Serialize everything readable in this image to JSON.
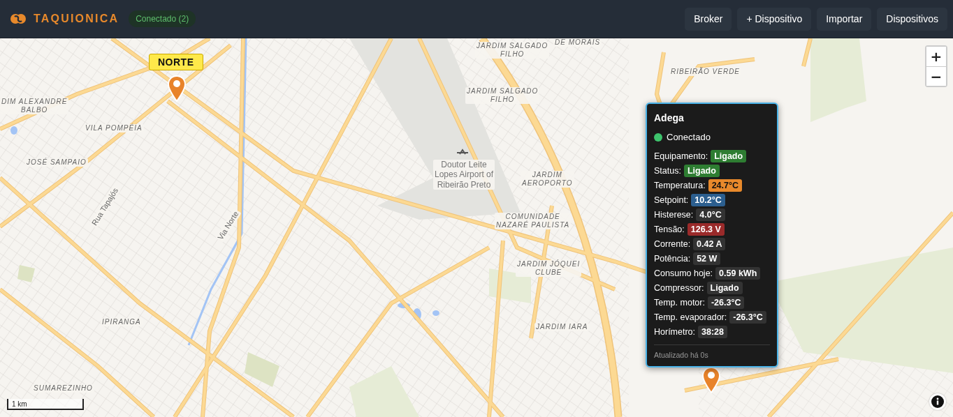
{
  "header": {
    "brand": "TAQUIONICA",
    "connection": "Conectado (2)",
    "buttons": [
      "Broker",
      "+ Dispositivo",
      "Importar",
      "Dispositivos"
    ]
  },
  "map": {
    "labels": [
      {
        "text": "JARDIM SALGADO\nFILHO",
        "kind": "district"
      },
      {
        "text": "DE MORAIS",
        "kind": "district"
      },
      {
        "text": "RIBEIRÃO VERDE",
        "kind": "district"
      },
      {
        "text": "DIM ALEXANDRE\nBALBO",
        "kind": "district"
      },
      {
        "text": "VILA POMPÉIA",
        "kind": "district"
      },
      {
        "text": "JOSÉ SAMPAIO",
        "kind": "district"
      },
      {
        "text": "JARDIM SALGADO\nFILHO",
        "kind": "district"
      },
      {
        "text": "Doutor Leite\nLopes Airport of\nRibeirão Preto",
        "kind": "poi"
      },
      {
        "text": "JARDIM\nAEROPORTO",
        "kind": "district"
      },
      {
        "text": "COMUNIDADE\nNAZARÉ PAULISTA",
        "kind": "district"
      },
      {
        "text": "JARDIM JÓQUEI\nCLUBE",
        "kind": "district"
      },
      {
        "text": "JARDIM IARA",
        "kind": "district"
      },
      {
        "text": "IPIRANGA",
        "kind": "district"
      },
      {
        "text": "SUMAREZINHO",
        "kind": "district"
      },
      {
        "text": "Rua Tapajós",
        "kind": "street"
      },
      {
        "text": "Via Norte",
        "kind": "street"
      }
    ],
    "markers": [
      {
        "kind": "tagged",
        "label": "NORTE"
      },
      {
        "kind": "plain"
      }
    ],
    "zoom_buttons": [
      "+",
      "−"
    ],
    "scale": "1 km"
  },
  "popup": {
    "title": "Adega",
    "status": {
      "text": "Conectado",
      "color": "#3ec46d"
    },
    "rows": [
      {
        "label": "Equipamento:",
        "value": "Ligado",
        "color": "#2e7d32"
      },
      {
        "label": "Status:",
        "value": "Ligado",
        "color": "#2e7d32"
      },
      {
        "label": "Temperatura:",
        "value": "24.7°C",
        "color": "#e8892b"
      },
      {
        "label": "Setpoint:",
        "value": "10.2°C",
        "color": "#2c5f8f"
      },
      {
        "label": "Histerese:",
        "value": "4.0°C",
        "color": "#333333"
      },
      {
        "label": "Tensão:",
        "value": "126.3 V",
        "color": "#9a2a2a"
      },
      {
        "label": "Corrente:",
        "value": "0.42 A",
        "color": "#333333"
      },
      {
        "label": "Potência:",
        "value": "52 W",
        "color": "#333333"
      },
      {
        "label": "Consumo hoje:",
        "value": "0.59 kWh",
        "color": "#333333"
      },
      {
        "label": "Compressor:",
        "value": "Ligado",
        "color": "#333333"
      },
      {
        "label": "Temp. motor:",
        "value": "-26.3°C",
        "color": "#333333"
      },
      {
        "label": "Temp. evaporador:",
        "value": "-26.3°C",
        "color": "#333333"
      },
      {
        "label": "Horímetro:",
        "value": "38:28",
        "color": "#333333"
      }
    ],
    "footer": "Atualizado há 0s"
  }
}
